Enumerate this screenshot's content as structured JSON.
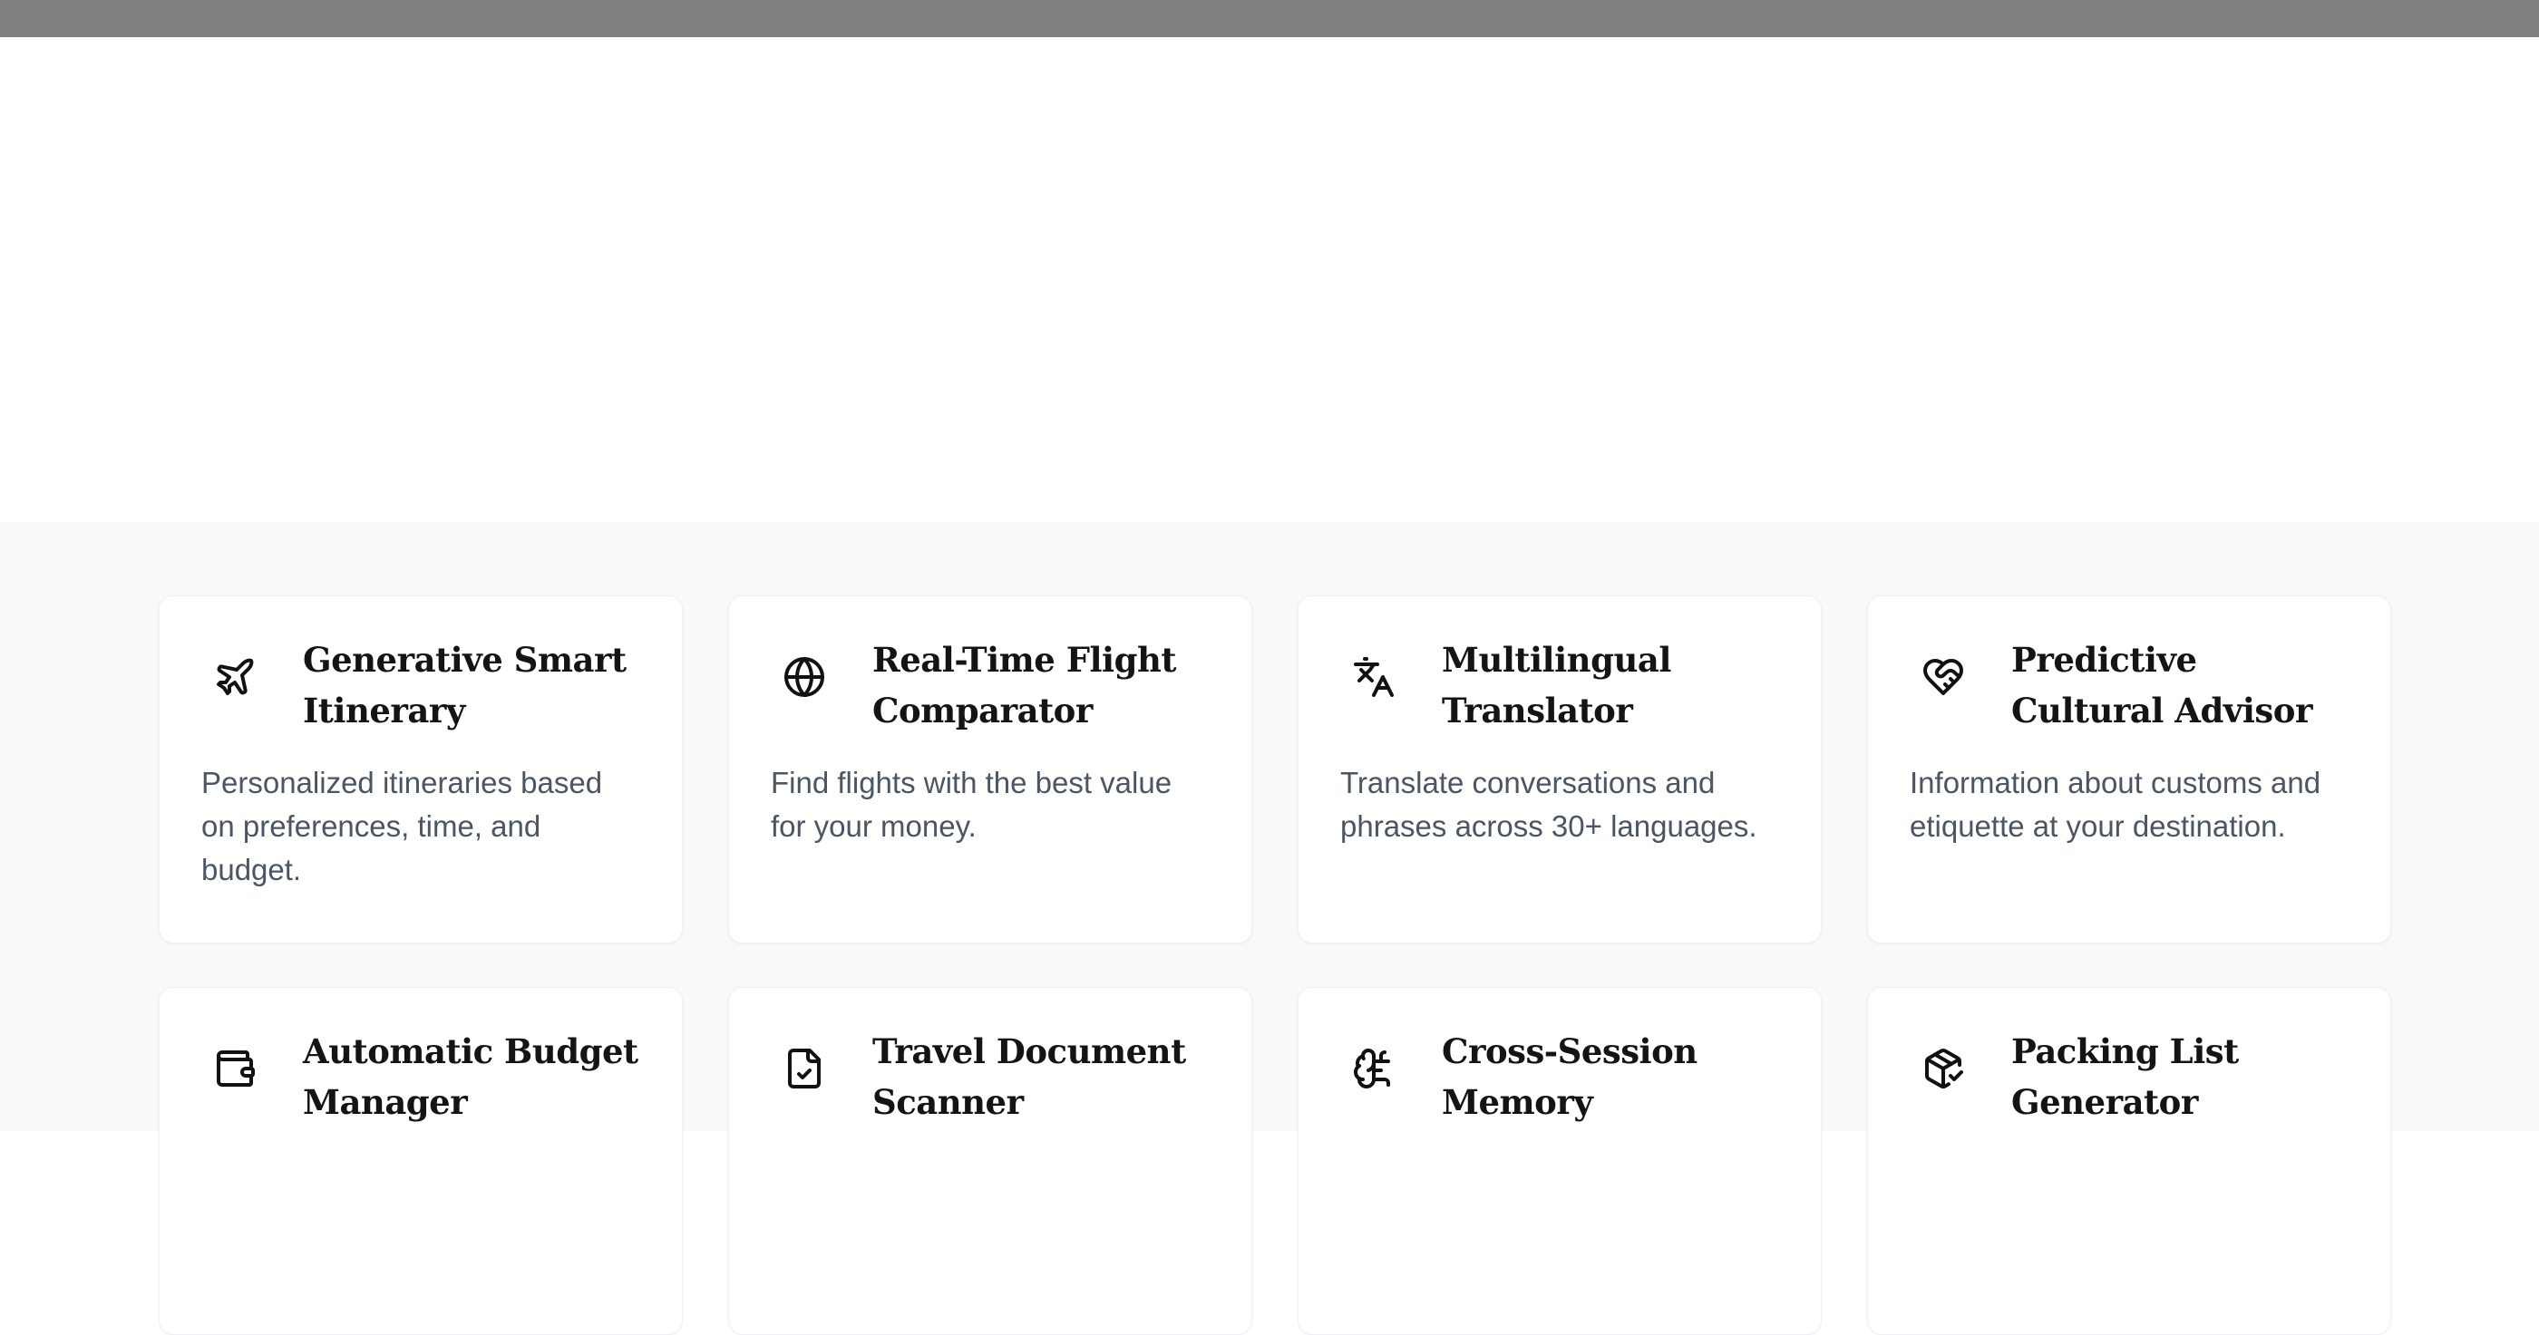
{
  "features": {
    "cards": [
      {
        "icon": "airplane-icon",
        "title": "Generative Smart Itinerary",
        "description": "Personalized itineraries based on preferences, time, and budget."
      },
      {
        "icon": "globe-icon",
        "title": "Real-Time Flight Comparator",
        "description": "Find flights with the best value for your money."
      },
      {
        "icon": "translate-icon",
        "title": "Multilingual Translator",
        "description": "Translate conversations and phrases across 30+ languages."
      },
      {
        "icon": "handshake-heart-icon",
        "title": "Predictive Cultural Advisor",
        "description": "Information about customs and etiquette at your destination."
      },
      {
        "icon": "wallet-icon",
        "title": "Automatic Budget Manager",
        "description": ""
      },
      {
        "icon": "file-check-icon",
        "title": "Travel Document Scanner",
        "description": ""
      },
      {
        "icon": "brain-icon",
        "title": "Cross-Session Memory",
        "description": ""
      },
      {
        "icon": "package-check-icon",
        "title": "Packing List Generator",
        "description": ""
      }
    ]
  }
}
